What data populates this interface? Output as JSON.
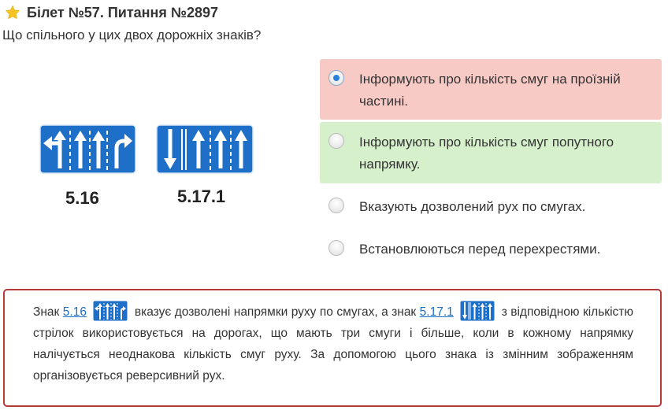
{
  "header": {
    "star_icon": "star-icon",
    "star_color": "#f6c324",
    "title": "Білет №57. Питання №2897"
  },
  "question": "Що спільного у цих двох дорожніх знаків?",
  "signs": [
    {
      "label": "5.16",
      "color": "#1e6fc7"
    },
    {
      "label": "5.17.1",
      "color": "#1e6fc7"
    }
  ],
  "answers": [
    {
      "text": "Інформують про кількість смуг на проїзній частині.",
      "state": "wrong",
      "selected": true
    },
    {
      "text": "Інформують про кількість смуг попутного напрямку.",
      "state": "correct",
      "selected": false
    },
    {
      "text": "Вказують дозволений рух по смугах.",
      "state": "neutral",
      "selected": false
    },
    {
      "text": "Встановлюються перед перехрестями.",
      "state": "neutral",
      "selected": false
    }
  ],
  "colors": {
    "wrong_bg": "#f7cac6",
    "correct_bg": "#d6f0cc",
    "explain_border": "#b53a3a",
    "link": "#1a6fc2"
  },
  "explanation": {
    "part1": "Знак",
    "link1": "5.16",
    "part2": "вказує дозволені напрямки руху по смугах, а знак",
    "link2": "5.17.1",
    "part3": "з відповідною кількістю стрілок використовується на дорогах, що мають три смуги і більше, коли в кожному напрямку налічується неоднакова кількість смуг руху. За допомогою цього знака із змінним зображенням організовується реверсивний рух."
  }
}
